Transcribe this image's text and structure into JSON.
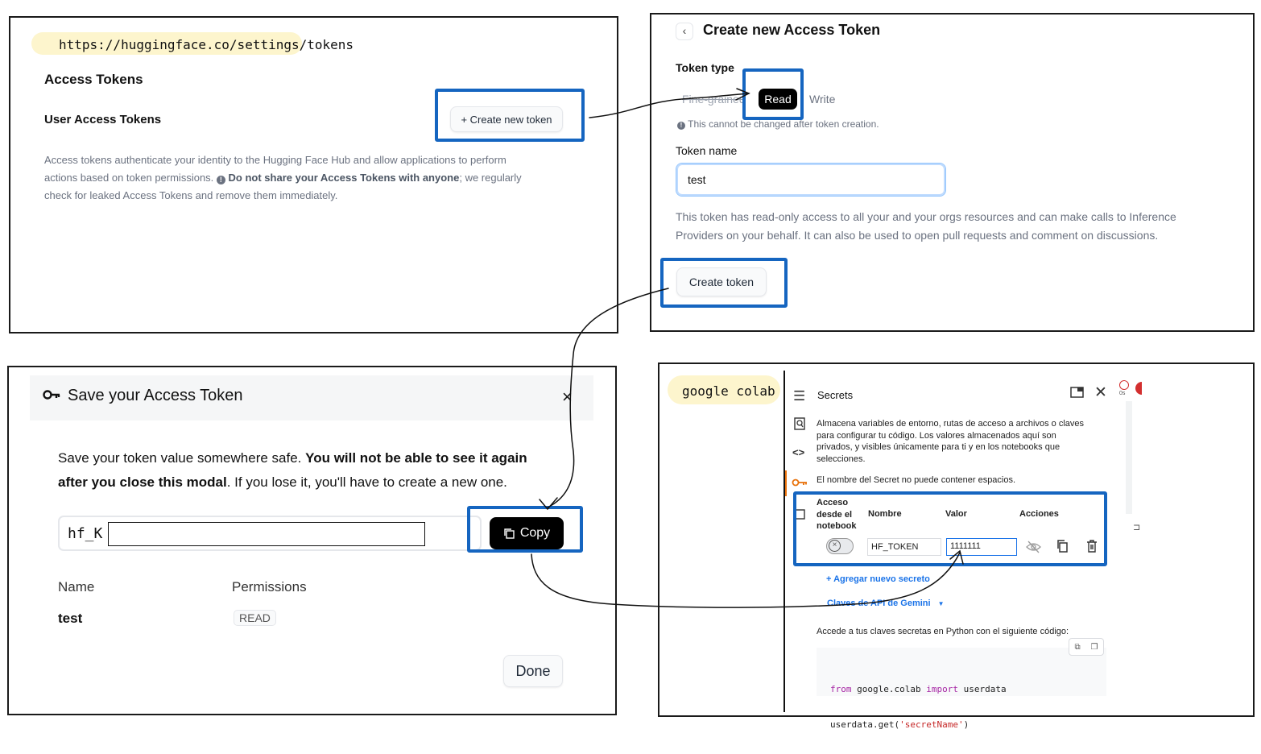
{
  "panel1": {
    "url": "https://huggingface.co/settings/tokens",
    "title": "Access Tokens",
    "subtitle": "User Access Tokens",
    "create_button": "+ Create new token",
    "desc_a": "Access tokens authenticate your identity to the Hugging Face Hub and allow applications to perform",
    "desc_b1": "actions based on token permissions.",
    "desc_b_bold": "Do not share your Access Tokens with anyone",
    "desc_b2": "; we regularly",
    "desc_c": "check for leaked Access Tokens and remove them immediately."
  },
  "panel2": {
    "back": "‹",
    "title": "Create new Access Token",
    "token_type_label": "Token type",
    "type_options": [
      "Fine-grained",
      "Read",
      "Write"
    ],
    "selected_type": "Read",
    "note": "This cannot be changed after token creation.",
    "name_label": "Token name",
    "name_value": "test",
    "desc_a": "This token has read-only access to all your and your orgs resources and can make calls to Inference",
    "desc_b": "Providers on your behalf. It can also be used to open pull requests and comment on discussions.",
    "create_button": "Create token"
  },
  "panel3": {
    "title": "Save your Access Token",
    "close": "×",
    "msg_a1": "Save your token value somewhere safe.",
    "msg_a_bold": "You will not be able to see it again",
    "msg_b_bold": "after you close this modal",
    "msg_b2": ". If you lose it, you'll have to create a new one.",
    "token_prefix": "hf_K",
    "copy_button": "Copy",
    "col_name": "Name",
    "col_permissions": "Permissions",
    "name_value": "test",
    "permission_badge": "READ",
    "done_button": "Done"
  },
  "panel4": {
    "label": "google colab",
    "title": "Secrets",
    "desc_lines": [
      "Almacena variables de entorno, rutas de acceso a archivos o claves",
      "para configurar tu código. Los valores almacenados aquí son",
      "privados, y visibles únicamente para ti y en los notebooks que",
      "selecciones."
    ],
    "warning": "El nombre del Secret no puede contener espacios.",
    "col_access": [
      "Acceso",
      "desde el",
      "notebook"
    ],
    "col_name": "Nombre",
    "col_value": "Valor",
    "col_actions": "Acciones",
    "secret_name": "HF_TOKEN",
    "secret_value": "1111111",
    "add_secret": "+ Agregar nuevo secreto",
    "gemini_keys": "Claves de API de Gemini",
    "access_note": "Accede a tus claves secretas en Python con el siguiente código:",
    "code_from": "from",
    "code_module": " google.colab ",
    "code_import": "import",
    "code_name": " userdata",
    "code_line2a": "userdata.get(",
    "code_line2b": "'secretName'",
    "code_line2c": ")",
    "timer": "0s"
  },
  "colors": {
    "highlight": "#1565c0",
    "colab_blue": "#1a73e8",
    "colab_orange": "#e8710a",
    "code_purple": "#a626a4",
    "code_red": "#c62828"
  }
}
